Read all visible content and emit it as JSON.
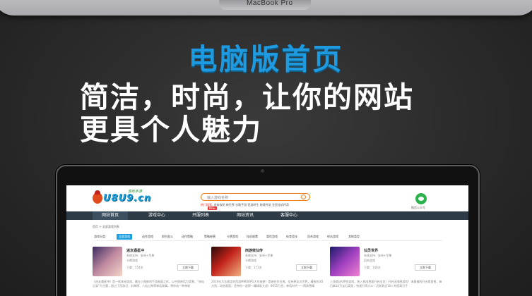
{
  "top_device": {
    "brand": "MacBook Pro"
  },
  "headline": {
    "title": "电脑版首页",
    "line1": "简洁，时尚，让你的网站",
    "line2": "更具个人魅力"
  },
  "site": {
    "logo_text": "U8U9.cn",
    "logo_tag": "游戏手游",
    "search_placeholder": "输入游戏名称",
    "hot_label": "热门搜索:",
    "hot_terms": "追来攻防 新世界 谷歌手游 西游转生 秘境传说 全民挂机传奇",
    "wechat_label": "微信公众号",
    "nav": [
      "网站首页",
      "游戏中心",
      "开服列表",
      "网站资讯",
      "客服中心"
    ],
    "nav_badge": "New",
    "breadcrumb": "首页 > 全部游戏列表",
    "filter_label": "游戏分类:",
    "filters": [
      "全部游戏",
      "动作游戏",
      "即时战斗",
      "动作策略",
      "策略经营",
      "卡牌游戏",
      "挂机放置",
      "冒险游戏",
      "体育竞技",
      "回合游戏",
      "射击游戏",
      "其他类型"
    ],
    "cards": [
      {
        "name": "逍友遇星冲",
        "platform": "系统支持：安卓+苹果",
        "type": "卡牌游戏",
        "downloads": "下载：554次",
        "button": "立即下载",
        "desc": "《逍友遇星冲》是一款休闲游戏，最左小角鲜的手游画面之作。以中国神话为背景，“修仙记录”为主题，超过了西游记、封神榜、八仙过海等神话故事。将你选一种神秘"
      },
      {
        "name": "西游修仙传",
        "platform": "系统支持：安卓+苹果",
        "type": "卡牌游戏",
        "downloads": "下载：173次",
        "button": "立即下载",
        "desc": "2019年为法规定的西游MMORPG大作来袭！是继往作古典，坚持原本次世界，精致的3D刀剑，动态画面，还带你一起探一幕精彩大战！8055万战，神话时代——两阵营精"
      },
      {
        "name": "仙灵世界",
        "platform": "系统支持：安卓+苹果",
        "type": "回合游戏",
        "downloads": "下载：146次",
        "button": "立即下载",
        "desc": "上线就送VIP的游戏，装入挑战界面开启出发！开启无限制游戏！海量福利开天赛首夜，每日拿10万宝石奖励，快速打得大众！活跃到这10人并提高日子"
      }
    ]
  }
}
